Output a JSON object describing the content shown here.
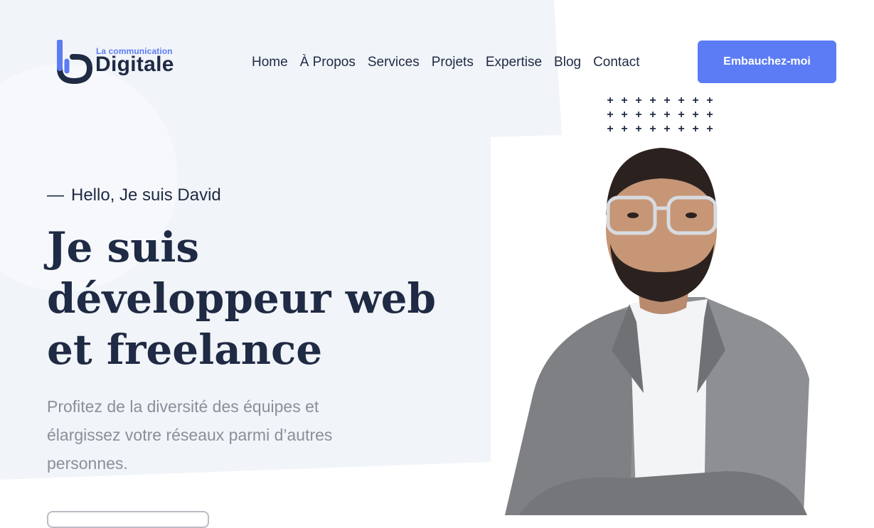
{
  "logo": {
    "tagline": "La communication",
    "name": "Digitale",
    "mark_color": "#5b7cf5",
    "text_color": "#1f2a44"
  },
  "nav": {
    "items": [
      {
        "label": "Home"
      },
      {
        "label": "À Propos"
      },
      {
        "label": "Services"
      },
      {
        "label": "Projets"
      },
      {
        "label": "Expertise"
      },
      {
        "label": "Blog"
      },
      {
        "label": "Contact"
      }
    ]
  },
  "header": {
    "hire_label": "Embauchez-moi"
  },
  "hero": {
    "greeting_dash": "—",
    "greeting": "Hello, Je suis David",
    "title_lines": [
      "Je suis",
      "développeur web",
      "et freelance"
    ],
    "description": "Profitez de la diversité des équipes et élargissez votre réseaux parmi d’autres personnes."
  },
  "decor": {
    "plus_glyph": "+",
    "plus_count": 24
  },
  "colors": {
    "accent": "#5b7cf5",
    "dark": "#1f2a44",
    "muted": "#8a8f9a",
    "background_tint": "#f1f4f8"
  }
}
